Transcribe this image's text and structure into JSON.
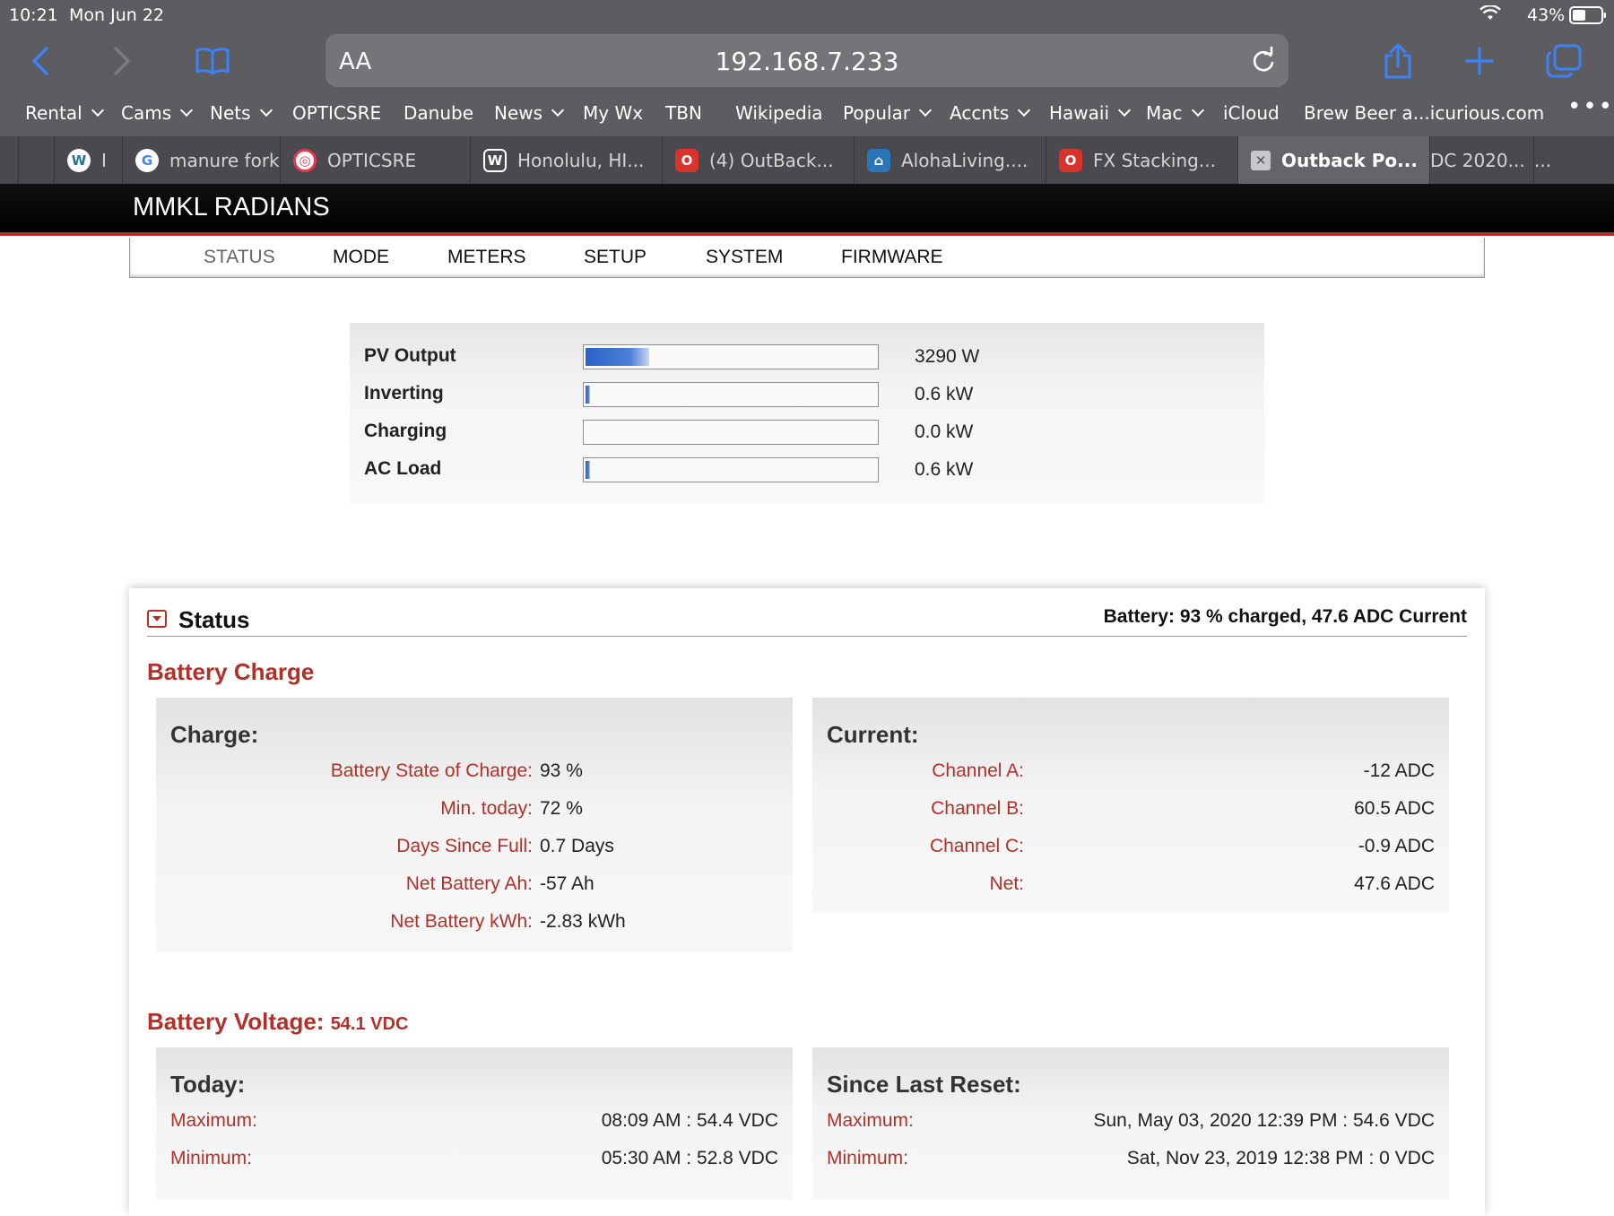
{
  "status_bar": {
    "time": "10:21",
    "date": "Mon Jun 22",
    "battery": "43%"
  },
  "browser": {
    "aa_label": "AA",
    "url": "192.168.7.233",
    "favorites": [
      "Rental",
      "Cams",
      "Nets",
      "OPTICSRE",
      "Danube",
      "News",
      "My Wx",
      "TBN",
      "Wikipedia",
      "Popular",
      "Accnts",
      "Hawaii",
      "Mac",
      "iCloud",
      "Brew Beer a...icurious.com"
    ],
    "tabs": [
      "I",
      "manure fork.",
      "OPTICSRE",
      "Honolulu, HI...",
      "(4) OutBack...",
      "AlohaLiving....",
      "FX Stacking...",
      "Outback Po...",
      "DC 2020...",
      "..."
    ]
  },
  "app": {
    "title": "MMKL RADIANS"
  },
  "menu": [
    "STATUS",
    "MODE",
    "METERS",
    "SETUP",
    "SYSTEM",
    "FIRMWARE"
  ],
  "summary": [
    {
      "label": "PV Output",
      "value": "3290 W",
      "level": 0.22
    },
    {
      "label": "Inverting",
      "value": "0.6 kW",
      "level": 0.015
    },
    {
      "label": "Charging",
      "value": "0.0 kW",
      "level": 0
    },
    {
      "label": "AC Load",
      "value": "0.6 kW",
      "level": 0.015
    }
  ],
  "status": {
    "title": "Status",
    "summary": "Battery: 93 % charged, 47.6 ADC Current",
    "battery_charge_heading": "Battery Charge",
    "charge": {
      "heading": "Charge:",
      "rows": [
        {
          "label": "Battery State of Charge:",
          "value": "93 %"
        },
        {
          "label": "Min. today:",
          "value": "72 %"
        },
        {
          "label": "Days Since Full:",
          "value": "0.7 Days"
        },
        {
          "label": "Net Battery Ah:",
          "value": "-57 Ah"
        },
        {
          "label": "Net Battery kWh:",
          "value": "-2.83 kWh"
        }
      ]
    },
    "current": {
      "heading": "Current:",
      "rows": [
        {
          "label": "Channel A:",
          "value": "-12 ADC"
        },
        {
          "label": "Channel B:",
          "value": "60.5 ADC"
        },
        {
          "label": "Channel C:",
          "value": "-0.9 ADC"
        },
        {
          "label": "Net:",
          "value": "47.6 ADC"
        }
      ]
    },
    "voltage_heading": "Battery Voltage:",
    "voltage_value": "54.1 VDC",
    "today": {
      "heading": "Today:",
      "rows": [
        {
          "label": "Maximum:",
          "value": "08:09 AM : 54.4 VDC"
        },
        {
          "label": "Minimum:",
          "value": "05:30 AM : 52.8 VDC"
        }
      ]
    },
    "since_reset": {
      "heading": "Since Last Reset:",
      "rows": [
        {
          "label": "Maximum:",
          "value": "Sun, May 03, 2020 12:39 PM : 54.6 VDC"
        },
        {
          "label": "Minimum:",
          "value": "Sat, Nov 23, 2019 12:38 PM : 0 VDC"
        }
      ]
    }
  },
  "colors": {
    "accent": "#b3302a",
    "bar_fill": "#2a63c9",
    "chrome": "#5d5d61"
  }
}
